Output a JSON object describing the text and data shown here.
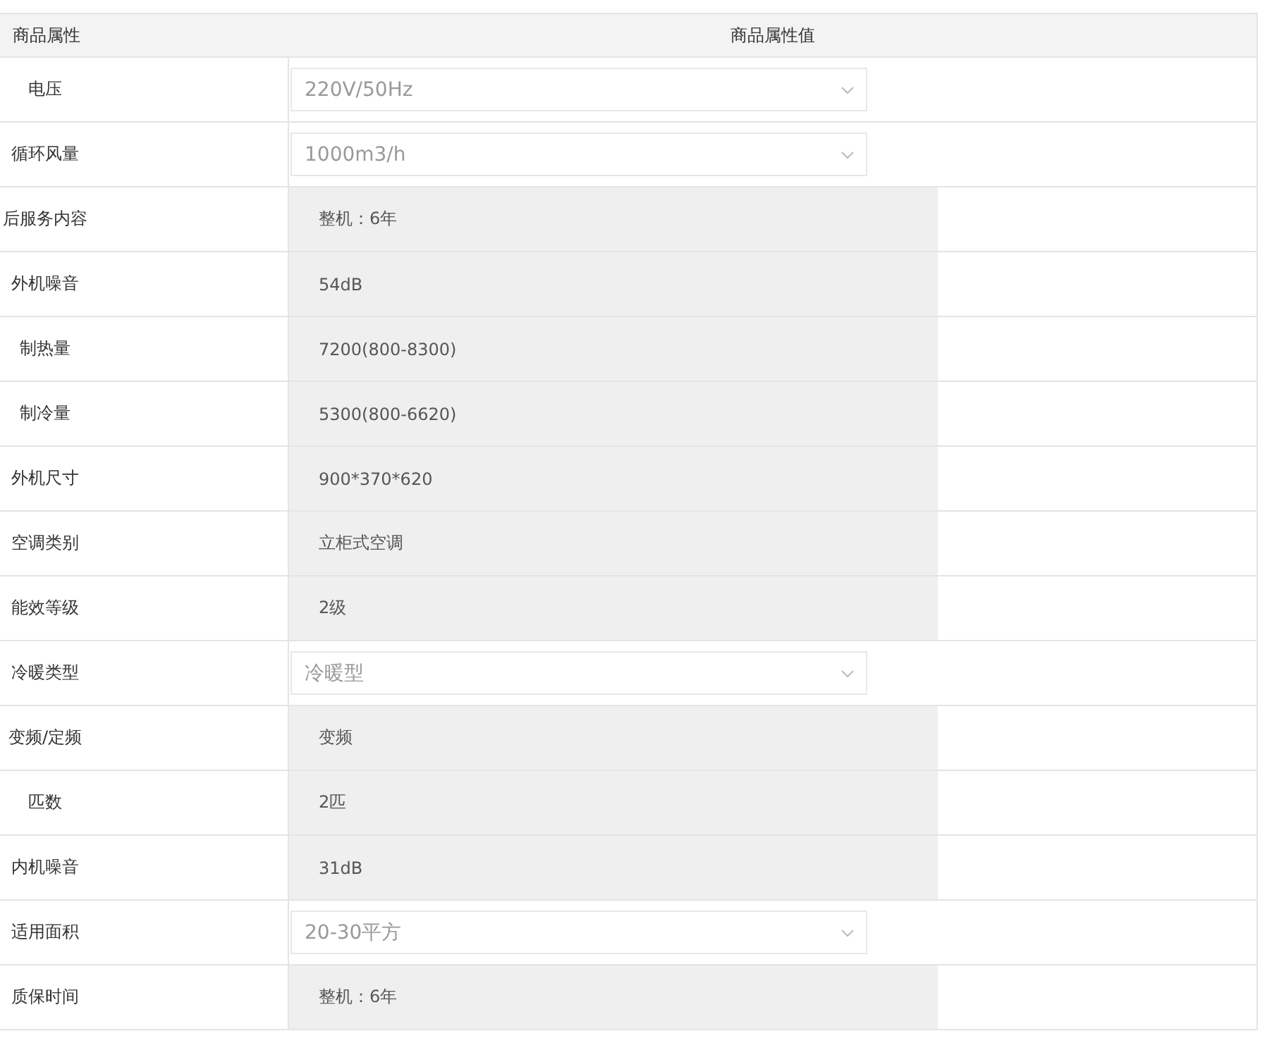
{
  "table": {
    "columns": [
      "商品属性",
      "商品属性值"
    ],
    "rows": [
      {
        "label": "电压",
        "kind": "select",
        "value": "220V/50Hz"
      },
      {
        "label": "循环风量",
        "kind": "select",
        "value": "1000m3/h"
      },
      {
        "label": "后服务内容",
        "kind": "text",
        "value": "整机：6年"
      },
      {
        "label": "外机噪音",
        "kind": "text",
        "value": "54dB"
      },
      {
        "label": "制热量",
        "kind": "text",
        "value": "7200(800-8300)"
      },
      {
        "label": "制冷量",
        "kind": "text",
        "value": "5300(800-6620)"
      },
      {
        "label": "外机尺寸",
        "kind": "text",
        "value": "900*370*620"
      },
      {
        "label": "空调类别",
        "kind": "text",
        "value": "立柜式空调"
      },
      {
        "label": "能效等级",
        "kind": "text",
        "value": "2级"
      },
      {
        "label": "冷暖类型",
        "kind": "select",
        "value": "冷暖型"
      },
      {
        "label": "变频/定频",
        "kind": "text",
        "value": "变频"
      },
      {
        "label": "匹数",
        "kind": "text",
        "value": "2匹"
      },
      {
        "label": "内机噪音",
        "kind": "text",
        "value": "31dB"
      },
      {
        "label": "适用面积",
        "kind": "select",
        "value": "20-30平方"
      },
      {
        "label": "质保时间",
        "kind": "text",
        "value": "整机：6年"
      }
    ]
  }
}
